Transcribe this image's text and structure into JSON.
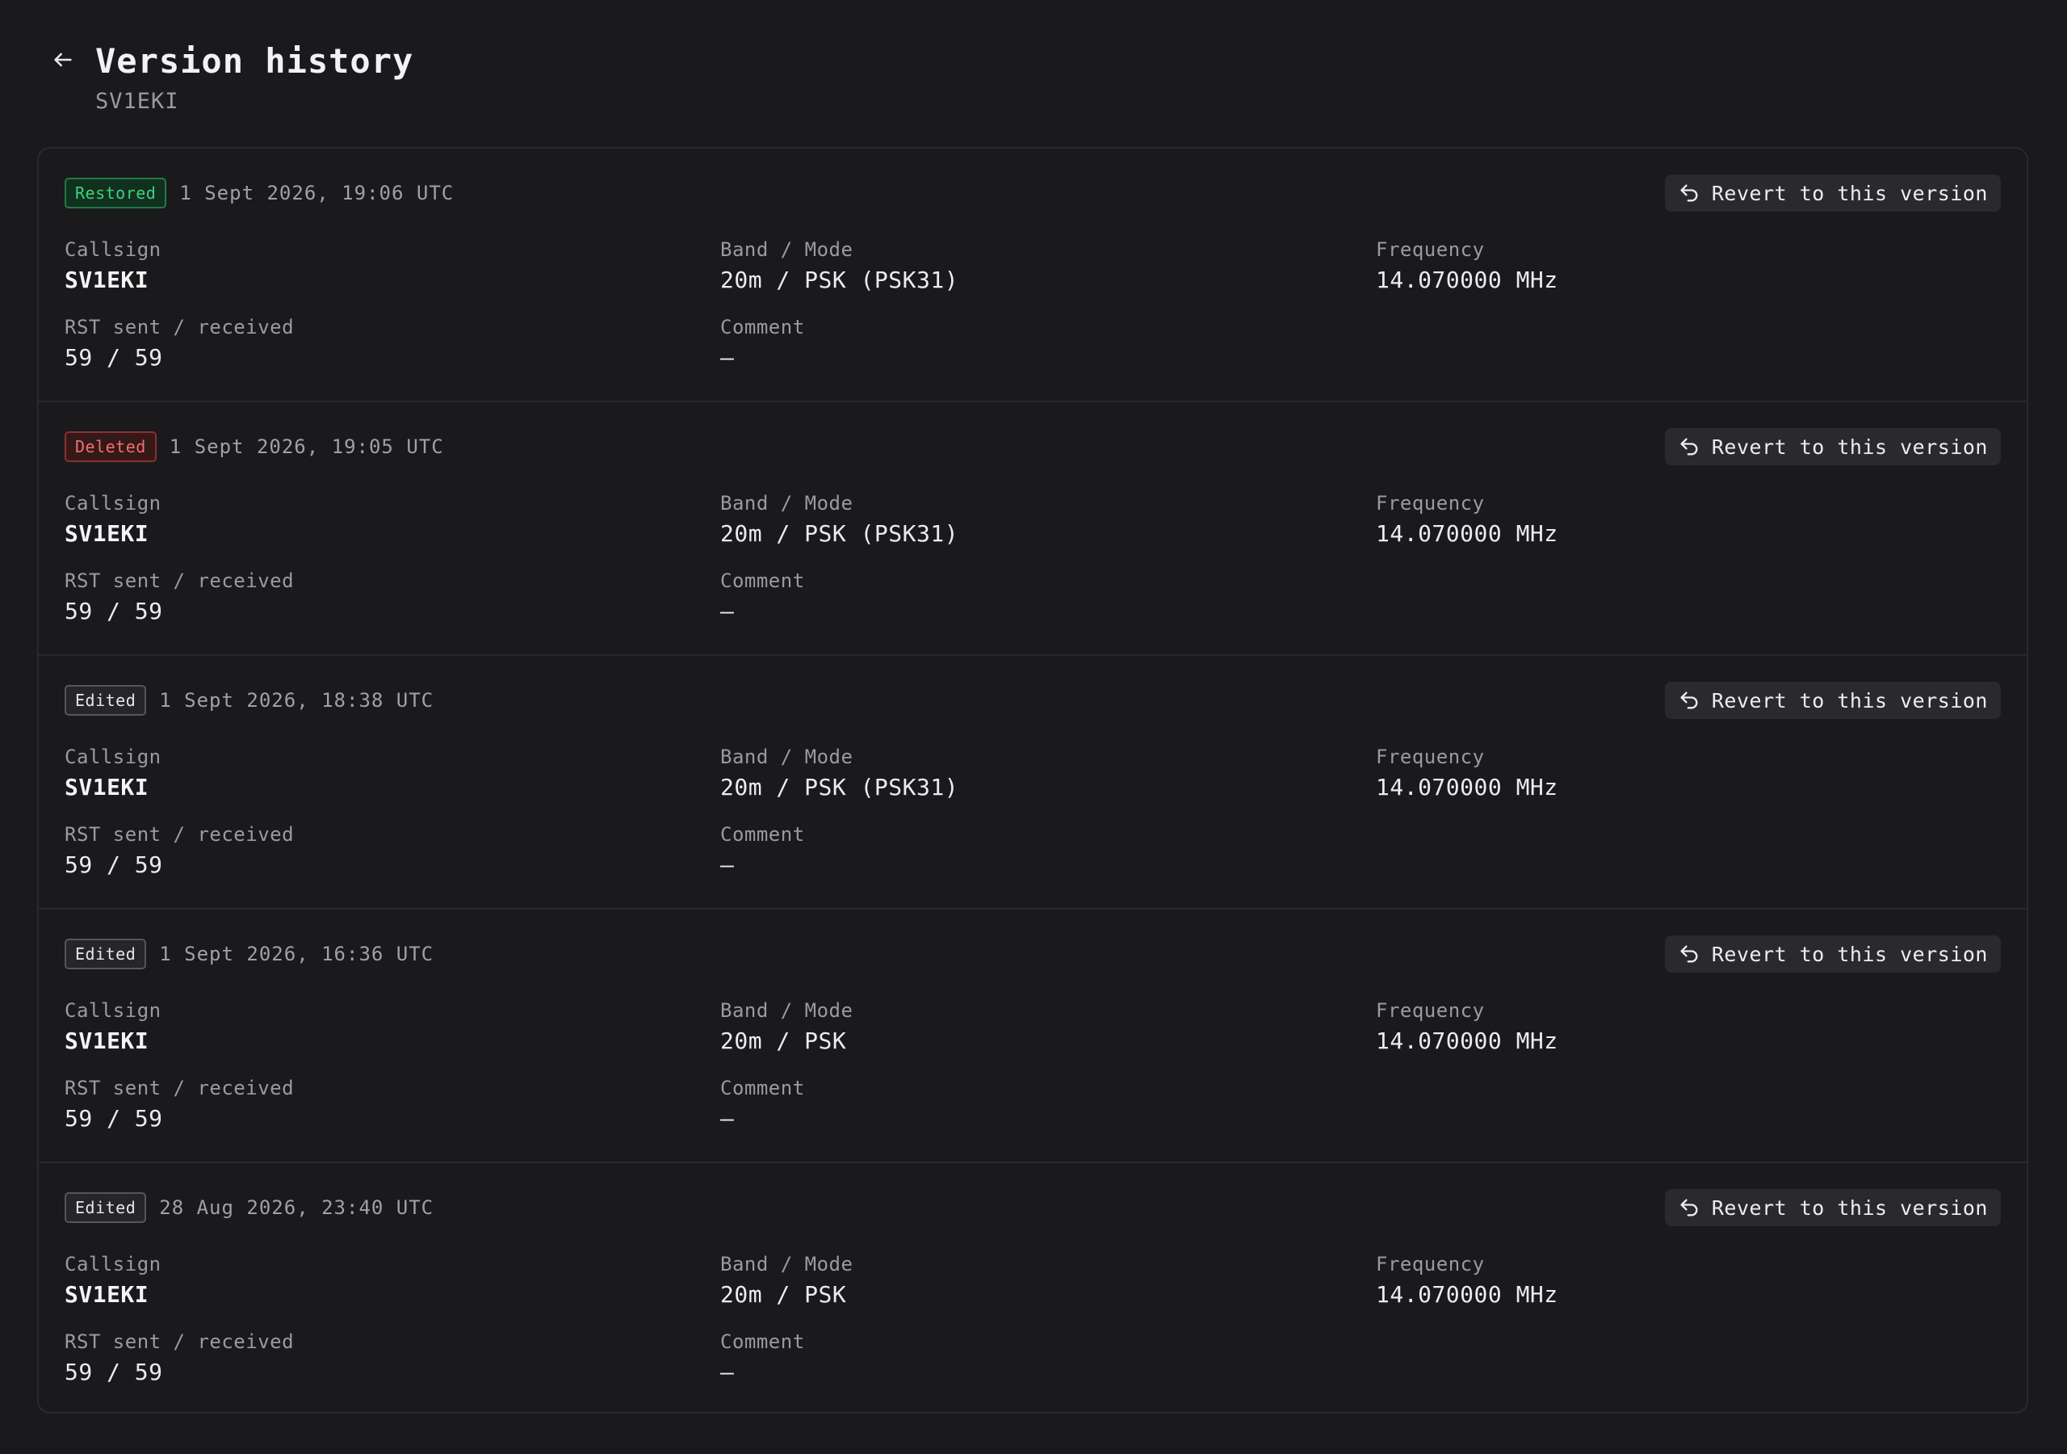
{
  "header": {
    "title": "Version history",
    "subtitle": "SV1EKI"
  },
  "labels": {
    "callsign": "Callsign",
    "band_mode": "Band / Mode",
    "frequency": "Frequency",
    "rst": "RST sent / received",
    "comment": "Comment",
    "revert": "Revert to this version"
  },
  "versions": [
    {
      "badge": "Restored",
      "timestamp": "1 Sept 2026, 19:06 UTC",
      "callsign": "SV1EKI",
      "band_mode": "20m / PSK (PSK31)",
      "frequency": "14.070000 MHz",
      "rst": "59 / 59",
      "comment": "—"
    },
    {
      "badge": "Deleted",
      "timestamp": "1 Sept 2026, 19:05 UTC",
      "callsign": "SV1EKI",
      "band_mode": "20m / PSK (PSK31)",
      "frequency": "14.070000 MHz",
      "rst": "59 / 59",
      "comment": "—"
    },
    {
      "badge": "Edited",
      "timestamp": "1 Sept 2026, 18:38 UTC",
      "callsign": "SV1EKI",
      "band_mode": "20m / PSK (PSK31)",
      "frequency": "14.070000 MHz",
      "rst": "59 / 59",
      "comment": "—"
    },
    {
      "badge": "Edited",
      "timestamp": "1 Sept 2026, 16:36 UTC",
      "callsign": "SV1EKI",
      "band_mode": "20m / PSK",
      "frequency": "14.070000 MHz",
      "rst": "59 / 59",
      "comment": "—"
    },
    {
      "badge": "Edited",
      "timestamp": "28 Aug 2026, 23:40 UTC",
      "callsign": "SV1EKI",
      "band_mode": "20m / PSK",
      "frequency": "14.070000 MHz",
      "rst": "59 / 59",
      "comment": "—"
    }
  ],
  "colors": {
    "background": "#1a1a1c",
    "restored": "#3ed27a",
    "deleted": "#f07070",
    "edited": "#e6e6e8"
  },
  "icons": {
    "back": "arrow-left-icon",
    "revert": "undo-arrow-icon"
  }
}
